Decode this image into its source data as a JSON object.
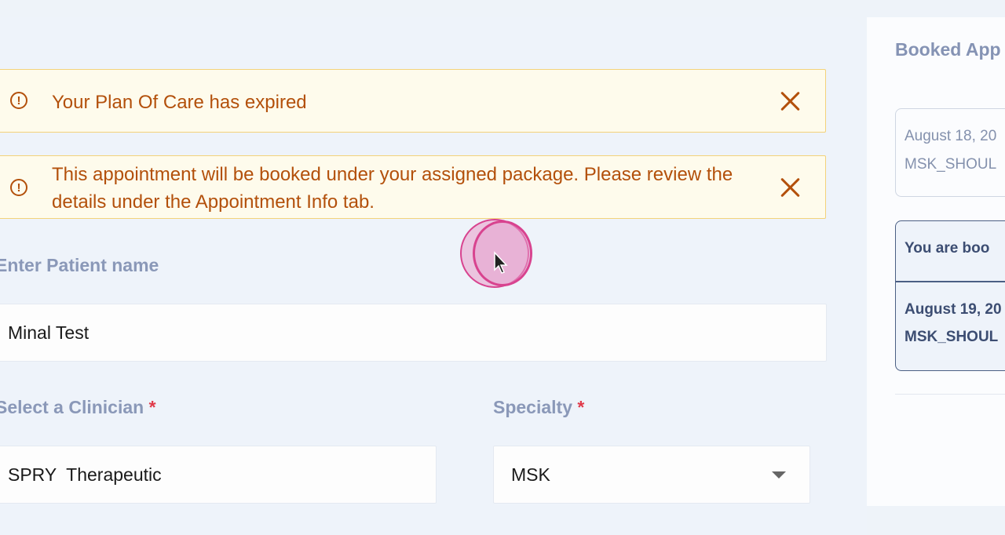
{
  "alerts": [
    {
      "text": "Your Plan Of Care has expired"
    },
    {
      "text": "This appointment will be booked under your assigned package. Please review the details under the Appointment Info tab."
    }
  ],
  "form": {
    "patient_label": "Enter Patient name",
    "patient_value": "Minal Test",
    "clinician_label": "Select a Clinician",
    "clinician_value": "SPRY  Therapeutic",
    "specialty_label": "Specialty",
    "specialty_value": "MSK",
    "required_mark": "*"
  },
  "side": {
    "title": "Booked App",
    "card1": {
      "line1": "August 18, 20",
      "line2": "MSK_SHOUL"
    },
    "card2": {
      "head": "You are boo",
      "line1": "August 19, 20",
      "line2": "MSK_SHOUL"
    }
  },
  "colors": {
    "alert_text": "#b3500b",
    "alert_border": "#f3d27a",
    "required": "#e03a4a",
    "label": "#8a98b8"
  }
}
